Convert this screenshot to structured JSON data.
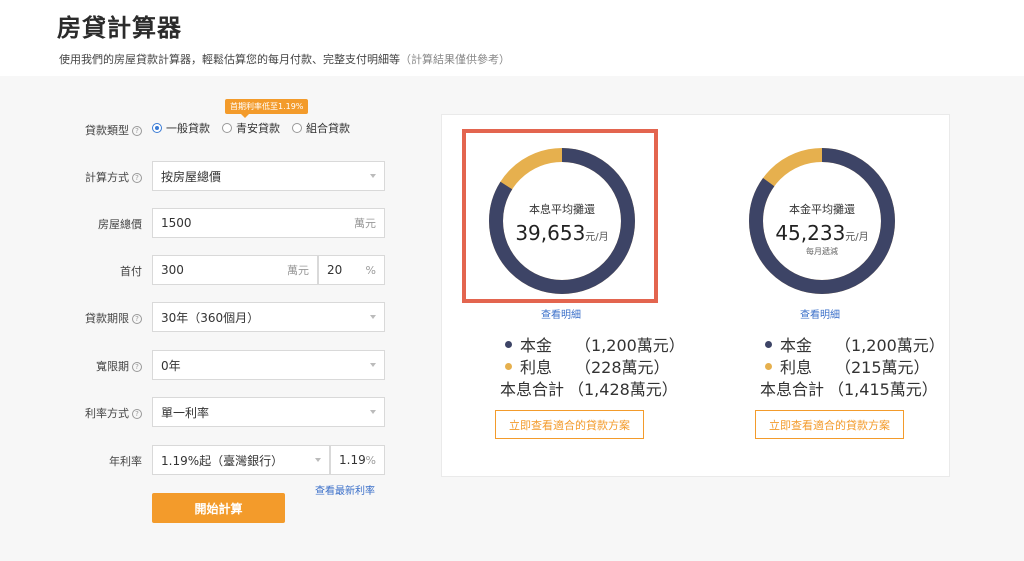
{
  "header": {
    "title": "房貸計算器",
    "subtitle": "使用我們的房屋貸款計算器，輕鬆估算您的每月付款、完整支付明細等",
    "subtitle_note": "（計算結果僅供參考）"
  },
  "form": {
    "loan_type": {
      "label": "貸款類型",
      "promo": "首期利率低至1.19%",
      "options": [
        "一般貸款",
        "青安貸款",
        "組合貸款"
      ],
      "selected": "一般貸款"
    },
    "calc_method": {
      "label": "計算方式",
      "value": "按房屋總價"
    },
    "house_price": {
      "label": "房屋總價",
      "value": "1500",
      "unit": "萬元"
    },
    "down_payment": {
      "label": "首付",
      "amount": "300",
      "amount_unit": "萬元",
      "percent": "20",
      "percent_unit": "%"
    },
    "loan_term": {
      "label": "貸款期限",
      "value": "30年（360個月）"
    },
    "grace_period": {
      "label": "寬限期",
      "value": "0年"
    },
    "rate_type": {
      "label": "利率方式",
      "value": "單一利率"
    },
    "annual_rate": {
      "label": "年利率",
      "value": "1.19%起（臺灣銀行）",
      "rate": "1.19",
      "rate_unit": "%"
    },
    "latest_rate_link": "查看最新利率",
    "calc_button": "開始計算"
  },
  "results": [
    {
      "caption": "本息平均攤還",
      "value": "39,653",
      "unit": "元/月",
      "sub": "",
      "principal_fraction": 0.84,
      "detail_link": "查看明細",
      "legend": [
        {
          "name": "本金",
          "value": "（1,200萬元）"
        },
        {
          "name": "利息",
          "value": "（228萬元）"
        }
      ],
      "total_label": "本息合計",
      "total_value": "（1,428萬元）",
      "plan_button": "立即查看適合的貸款方案"
    },
    {
      "caption": "本金平均攤還",
      "value": "45,233",
      "unit": "元/月",
      "sub": "每月遞減",
      "principal_fraction": 0.85,
      "detail_link": "查看明細",
      "legend": [
        {
          "name": "本金",
          "value": "（1,200萬元）"
        },
        {
          "name": "利息",
          "value": "（215萬元）"
        }
      ],
      "total_label": "本息合計",
      "total_value": "（1,415萬元）",
      "plan_button": "立即查看適合的貸款方案"
    }
  ],
  "colors": {
    "principal": "#3d4466",
    "interest": "#e6b04e",
    "accent": "#f39b2b",
    "link": "#3a6fc9",
    "highlight": "#e3654f"
  }
}
